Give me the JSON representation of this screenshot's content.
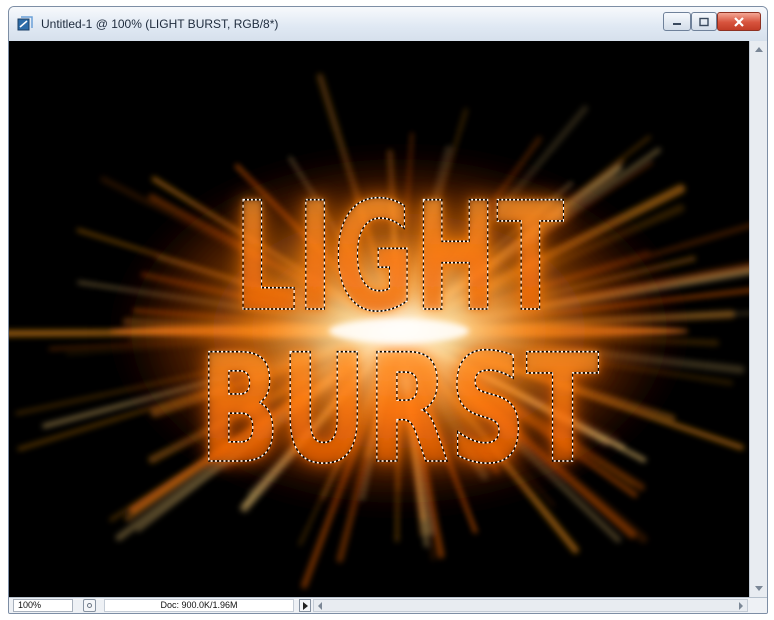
{
  "window": {
    "title": "Untitled-1 @ 100% (LIGHT BURST, RGB/8*)"
  },
  "canvas": {
    "line1": "LIGHT",
    "line2": "BURST",
    "background_color": "#000000",
    "glow_colors": [
      "#ff6a00",
      "#ff9a1a",
      "#ffd27a",
      "#ffffff"
    ]
  },
  "statusbar": {
    "zoom": "100%",
    "doc_info": "Doc: 900.0K/1.96M"
  },
  "icons": {
    "app": "photoshop-document-icon",
    "minimize": "minimize-icon",
    "maximize": "maximize-icon",
    "close": "close-icon"
  }
}
